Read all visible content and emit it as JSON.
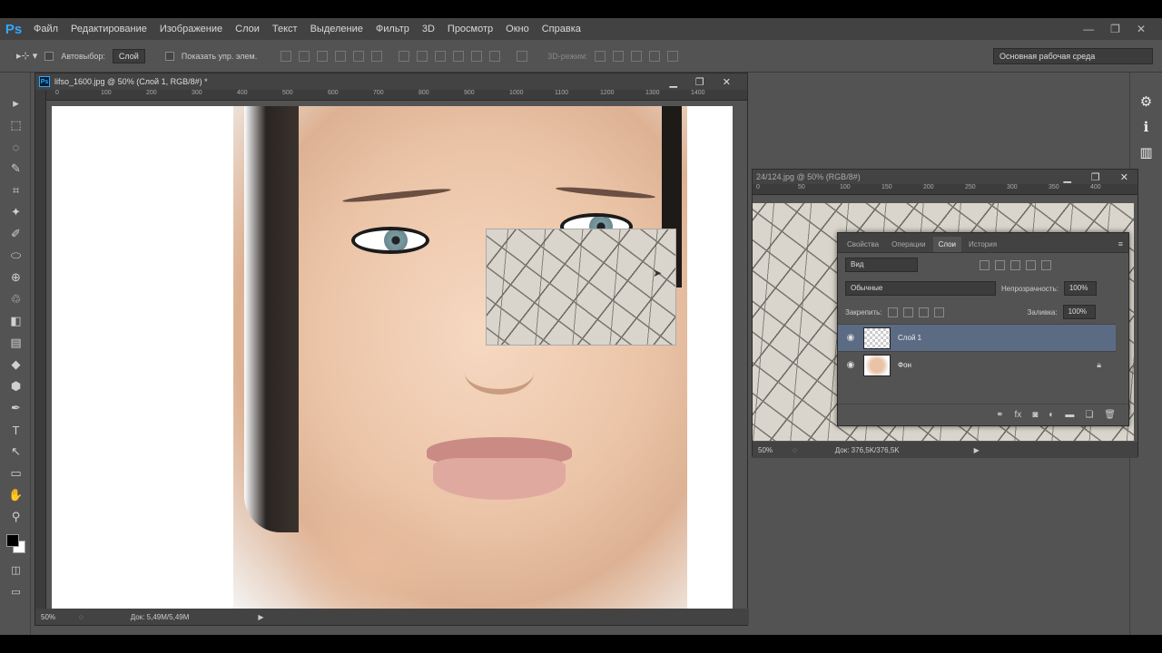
{
  "menubar": {
    "logo": "Ps",
    "items": [
      "Файл",
      "Редактирование",
      "Изображение",
      "Слои",
      "Текст",
      "Выделение",
      "Фильтр",
      "3D",
      "Просмотр",
      "Окно",
      "Справка"
    ],
    "controls": [
      "—",
      "❐",
      "✕"
    ]
  },
  "options": {
    "autoselect_label": "Автовыбор:",
    "autoselect_value": "Слой",
    "show_controls_label": "Показать упр. элем.",
    "mode_3d_label": "3D-режим:",
    "workspace": "Основная рабочая среда"
  },
  "tools": [
    "▸",
    "⬚",
    "◌",
    "✎",
    "⌗",
    "✦",
    "✐",
    "⬭",
    "⊕",
    "♲",
    "◧",
    "▤",
    "◆",
    "⬢",
    "✒",
    "T",
    "↖",
    "▭",
    "✋",
    "⚲"
  ],
  "dock": [
    "⚙",
    "ℹ",
    "▥"
  ],
  "doc1": {
    "title": "lifso_1600.jpg @ 50% (Слой 1, RGB/8#) *",
    "ruler_ticks": [
      "0",
      "100",
      "200",
      "300",
      "400",
      "500",
      "600",
      "700",
      "800",
      "900",
      "1000",
      "1100",
      "1200",
      "1300",
      "1400"
    ],
    "zoom": "50%",
    "doc_size": "Док: 5,49M/5,49M"
  },
  "doc2": {
    "title": "24/124.jpg @ 50% (RGB/8#)",
    "ruler_ticks": [
      "0",
      "50",
      "100",
      "150",
      "200",
      "250",
      "300",
      "350",
      "400"
    ],
    "zoom": "50%",
    "doc_size": "Док: 376,5K/376,5K"
  },
  "layers": {
    "tabs": [
      "Свойства",
      "Операции",
      "Слои",
      "История"
    ],
    "active_tab": "Слои",
    "filter": "Вид",
    "blend_mode": "Обычные",
    "opacity_label": "Непрозрачность:",
    "opacity_value": "100%",
    "lock_label": "Закрепить:",
    "fill_label": "Заливка:",
    "fill_value": "100%",
    "items": [
      {
        "name": "Слой 1",
        "selected": true
      },
      {
        "name": "Фон",
        "selected": false
      }
    ]
  }
}
